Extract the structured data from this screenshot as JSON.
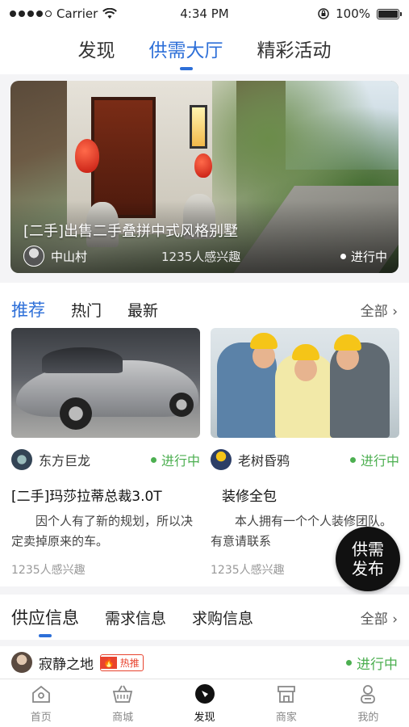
{
  "status_bar": {
    "carrier": "Carrier",
    "time": "4:34 PM",
    "battery": "100%"
  },
  "top_tabs": [
    {
      "label": "发现",
      "active": false
    },
    {
      "label": "供需大厅",
      "active": true
    },
    {
      "label": "精彩活动",
      "active": false
    }
  ],
  "hero": {
    "title": "[二手]出售二手叠拼中式风格别墅",
    "user": "中山村",
    "interest": "1235人感兴趣",
    "status": "进行中"
  },
  "recommend": {
    "tabs": [
      {
        "label": "推荐",
        "active": true
      },
      {
        "label": "热门",
        "active": false
      },
      {
        "label": "最新",
        "active": false
      }
    ],
    "all_label": "全部",
    "cards": [
      {
        "user": "东方巨龙",
        "status": "进行中",
        "title": "[二手]玛莎拉蒂总裁3.0T",
        "desc": "因个人有了新的规划，所以决定卖掉原来的车。",
        "interest": "1235人感兴趣"
      },
      {
        "user": "老树昏鸦",
        "status": "进行中",
        "title": "装修全包",
        "desc": "本人拥有一个个人装修团队。有意请联系",
        "interest": "1235人感兴趣"
      }
    ]
  },
  "fab": {
    "line1": "供需",
    "line2": "发布"
  },
  "supply": {
    "tabs": [
      {
        "label": "供应信息",
        "active": true
      },
      {
        "label": "需求信息",
        "active": false
      },
      {
        "label": "求购信息",
        "active": false
      }
    ],
    "all_label": "全部"
  },
  "post": {
    "user": "寂静之地",
    "badge": "热推",
    "status": "进行中"
  },
  "tabbar": [
    {
      "label": "首页",
      "icon": "home-icon",
      "active": false
    },
    {
      "label": "商城",
      "icon": "basket-icon",
      "active": false
    },
    {
      "label": "发现",
      "icon": "compass-icon",
      "active": true
    },
    {
      "label": "商家",
      "icon": "store-icon",
      "active": false
    },
    {
      "label": "我的",
      "icon": "profile-icon",
      "active": false
    }
  ],
  "colors": {
    "accent": "#2d6fd8",
    "status_green": "#4caf50",
    "hot_red": "#e8432e"
  }
}
